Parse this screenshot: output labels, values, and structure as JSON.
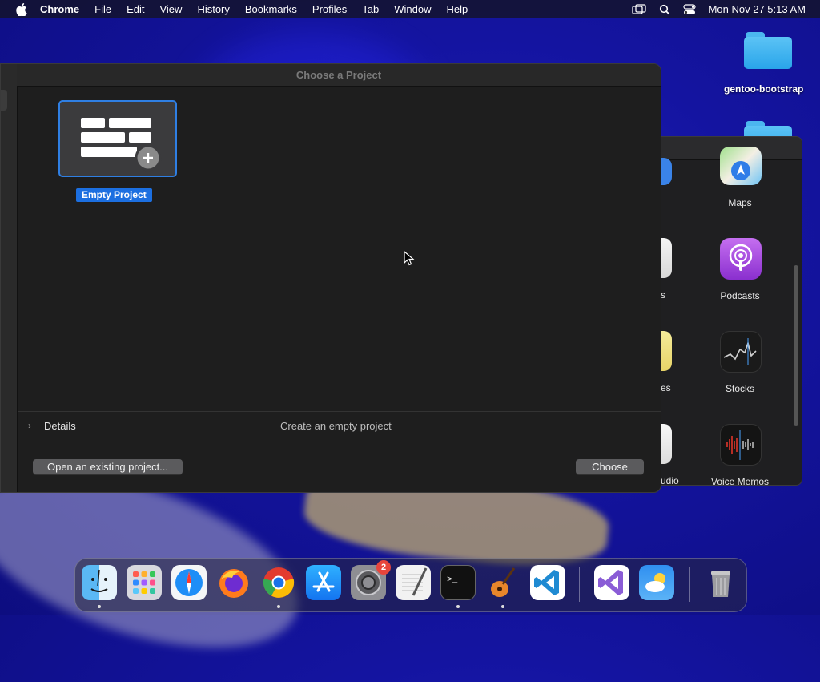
{
  "menubar": {
    "app_name": "Chrome",
    "items": [
      "File",
      "Edit",
      "View",
      "History",
      "Bookmarks",
      "Profiles",
      "Tab",
      "Window",
      "Help"
    ],
    "clock": "Mon Nov 27  5:13 AM"
  },
  "desktop": {
    "folder_label": "gentoo-bootstrap"
  },
  "background_window": {
    "apps": [
      "Maps",
      "Podcasts",
      "Stocks",
      "Voice Memos"
    ],
    "partial_labels": [
      "s",
      "es",
      "udio"
    ]
  },
  "dialog": {
    "title": "Choose a Project",
    "template_label": "Empty Project",
    "details_label": "Details",
    "details_description": "Create an empty project",
    "open_button": "Open an existing project...",
    "choose_button": "Choose",
    "accent_color": "#1c6fe0"
  },
  "dock": {
    "items": [
      "finder-icon",
      "launchpad-icon",
      "safari-icon",
      "firefox-icon",
      "chrome-icon",
      "app-store-icon",
      "system-settings-icon",
      "textedit-icon",
      "terminal-icon",
      "garageband-icon",
      "vscode-icon",
      "visual-studio-icon",
      "weather-icon",
      "trash-icon"
    ],
    "system_settings_badge": "2"
  }
}
